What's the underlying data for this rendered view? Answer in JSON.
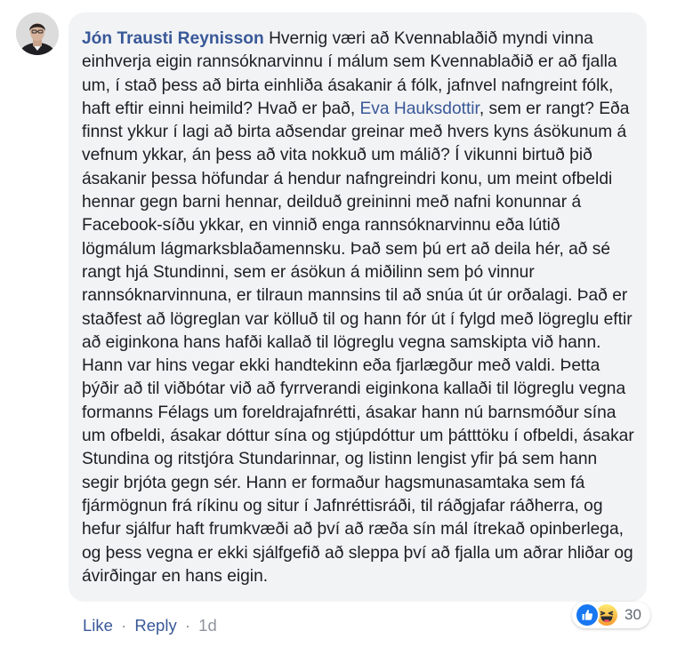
{
  "comment": {
    "author": "Jón Trausti Reynisson",
    "text_before_mention": " Hvernig væri að Kvennablaðið myndi vinna einhverja eigin rannsóknarvinnu í málum sem Kvennablaðið er að fjalla um, í stað þess að birta einhliða ásakanir á fólk, jafnvel nafngreint fólk, haft eftir einni heimild? Hvað er það, ",
    "mention": "Eva Hauksdottir",
    "text_after_mention": ", sem er rangt? Eða finnst ykkur í lagi að birta aðsendar greinar með hvers kyns ásökunum á vefnum ykkar, án þess að vita nokkuð um málið? Í vikunni birtuð þið ásakanir þessa höfundar á hendur nafngreindri konu, um meint ofbeldi hennar gegn barni hennar, deilduð greininni með nafni konunnar á Facebook-síðu ykkar, en vinnið enga rannsóknarvinnu eða lútið lögmálum lágmarksblaðamennsku. Það sem þú ert að deila hér, að sé rangt hjá Stundinni, sem er ásökun á miðilinn sem þó vinnur rannsóknarvinnuna, er tilraun mannsins til að snúa út úr orðalagi. Það er staðfest að lögreglan var kölluð til og hann fór út í fylgd með lögreglu eftir að eiginkona hans hafði kallað til lögreglu vegna samskipta við hann. Hann var hins vegar ekki handtekinn eða fjarlægður með valdi. Þetta þýðir að til viðbótar við að fyrrverandi eiginkona kallaði til lögreglu vegna formanns Félags um foreldrajafnrétti, ásakar hann nú barnsmóður sína um ofbeldi, ásakar dóttur sína og stjúpdóttur um þátttöku í ofbeldi, ásakar Stundina og ritstjóra Stundarinnar, og listinn lengist yfir þá sem hann segir brjóta gegn sér. Hann er formaður hagsmunasamtaka sem fá fjármögnun frá ríkinu og situr í Jafnréttisráði, til ráðgjafar ráðherra, og hefur sjálfur haft frumkvæði að því að ræða sín mál ítrekað opinberlega, og þess vegna er ekki sjálfgefið að sleppa því að fjalla um aðrar hliðar og ávirðingar en hans eigin."
  },
  "actions": {
    "like": "Like",
    "reply": "Reply",
    "separator": "·",
    "time": "1d"
  },
  "reactions": {
    "icons": [
      "like-icon",
      "haha-icon"
    ],
    "count": "30"
  },
  "colors": {
    "link": "#385898",
    "bubble": "#f2f3f5",
    "text": "#1c1e21",
    "meta": "#90949c",
    "like_blue": "#1877f2",
    "haha_yellow": "#f7b125"
  }
}
